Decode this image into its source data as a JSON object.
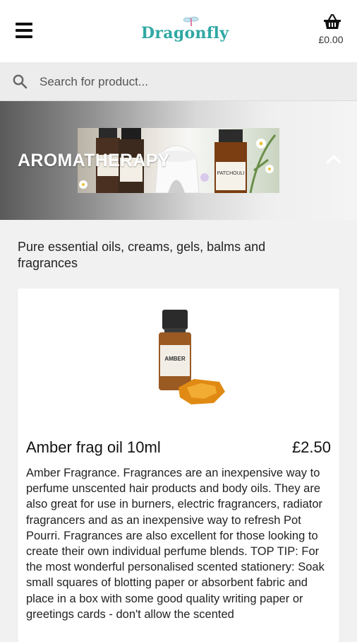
{
  "header": {
    "brand": "Dragonfly",
    "basket_total": "£0.00",
    "icons": {
      "menu": "hamburger-menu-icon",
      "basket": "shopping-basket-icon",
      "brand_mark": "dragonfly-icon"
    }
  },
  "search": {
    "placeholder": "Search for product...",
    "value": "",
    "icon": "search-icon"
  },
  "category": {
    "title": "AROMATHERAPY",
    "description": "Pure essential oils, creams, gels, balms and fragrances",
    "toggle_icon": "chevron-up-icon",
    "banner_photo_labels": [
      "PATCHOULI"
    ]
  },
  "product": {
    "name": "Amber frag oil 10ml",
    "price": "£2.50",
    "bottle_label": "AMBER",
    "description": "Amber Fragrance. Fragrances are an inexpensive way to perfume unscented hair products and body oils. They are also great for use in burners, electric fragrancers, radiator fragrancers and as an inexpensive way to refresh Pot Pourri. Fragrances are also excellent for those looking to create their own individual perfume blends. TOP TIP: For the most wonderful personalised scented stationery: Soak small squares of blotting paper or absorbent fabric and place in a box with some good quality writing paper or greetings cards - don't allow the scented"
  },
  "colors": {
    "brand": "#2fa8a3",
    "header_bg": "#ffffff",
    "page_bg": "#f1f1f1",
    "search_bg": "#ececec"
  }
}
